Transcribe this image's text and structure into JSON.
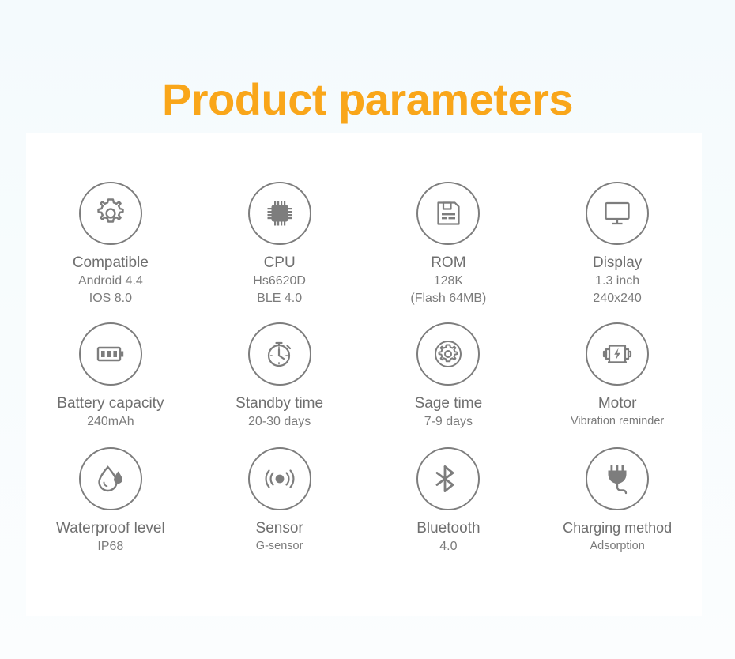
{
  "page": {
    "title": "Product parameters",
    "title_color": "#f9a61a",
    "background_color": "#f6fbfd",
    "card_color": "#ffffff",
    "icon_color": "#7d7d7d",
    "text_color": "#6f6f6f"
  },
  "specs": [
    {
      "icon": "gear-icon",
      "name": "Compatible",
      "line2": "Android 4.4",
      "line3": "IOS 8.0"
    },
    {
      "icon": "cpu-chip-icon",
      "name": "CPU",
      "line2": "Hs6620D",
      "line3": "BLE 4.0"
    },
    {
      "icon": "floppy-disk-icon",
      "name": "ROM",
      "line2": "128K",
      "line3": "(Flash 64MB)"
    },
    {
      "icon": "monitor-icon",
      "name": "Display",
      "line2": "1.3 inch",
      "line3": "240x240"
    },
    {
      "icon": "battery-icon",
      "name": "Battery capacity",
      "line2": "240mAh",
      "line3": ""
    },
    {
      "icon": "stopwatch-icon",
      "name": "Standby time",
      "line2": "20-30 days",
      "line3": ""
    },
    {
      "icon": "gear-in-circle-icon",
      "name": "Sage time",
      "line2": "7-9 days",
      "line3": ""
    },
    {
      "icon": "motor-icon",
      "name": "Motor",
      "line2": "Vibration reminder",
      "line3": ""
    },
    {
      "icon": "water-drop-icon",
      "name": "Waterproof level",
      "line2": "IP68",
      "line3": ""
    },
    {
      "icon": "g-sensor-icon",
      "name": "Sensor",
      "line2": "G-sensor",
      "line3": ""
    },
    {
      "icon": "bluetooth-icon",
      "name": "Bluetooth",
      "line2": "4.0",
      "line3": ""
    },
    {
      "icon": "power-plug-icon",
      "name": "Charging method",
      "line2": "Adsorption",
      "line3": ""
    }
  ]
}
